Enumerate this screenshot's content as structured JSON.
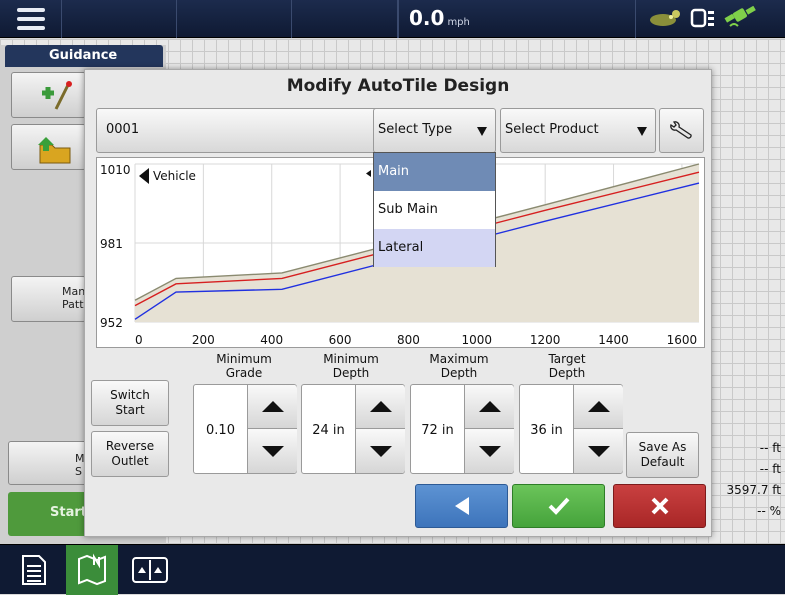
{
  "topbar": {
    "speed_value": "0.0",
    "speed_unit": "mph"
  },
  "background": {
    "guidance_tab": "Guidance",
    "btn_a": "N\nF",
    "btn_b": "L\nF",
    "btn_manage_pattern": "Man\nPatt",
    "btn_ms": "M\nS",
    "start_label": "Start",
    "stats": [
      "-- ft",
      "-- ft",
      "3597.7 ft",
      "-- %"
    ]
  },
  "modal": {
    "title": "Modify AutoTile Design",
    "name_value": "0001",
    "type_select": "Select Type",
    "product_select": "Select Product",
    "type_options": [
      "Main",
      "Sub Main",
      "Lateral"
    ],
    "switch_start": "Switch\nStart",
    "reverse_outlet": "Reverse\nOutlet",
    "save_default": "Save As\nDefault",
    "spinners": [
      {
        "label": "Minimum\nGrade",
        "value": "0.10"
      },
      {
        "label": "Minimum\nDepth",
        "value": "24 in"
      },
      {
        "label": "Maximum\nDepth",
        "value": "72 in"
      },
      {
        "label": "Target\nDepth",
        "value": "36 in"
      }
    ]
  },
  "chart_data": {
    "type": "line",
    "x_ticks": [
      "0",
      "200",
      "400",
      "600",
      "800",
      "1000",
      "1200",
      "1400",
      "1600"
    ],
    "y_ticks": [
      "952",
      "981",
      "1010"
    ],
    "xlim": [
      0,
      1650
    ],
    "ylim": [
      952,
      1010
    ],
    "annotations": [
      "Vehicle"
    ],
    "series": [
      {
        "color": "#8a8a70",
        "x": [
          0,
          120,
          430,
          1200,
          1650
        ],
        "values": [
          960,
          968,
          970,
          995,
          1010
        ]
      },
      {
        "color": "#d62020",
        "x": [
          0,
          120,
          430,
          1200,
          1650
        ],
        "values": [
          958,
          966,
          968,
          993,
          1007
        ]
      },
      {
        "color": "#2030e0",
        "x": [
          0,
          120,
          430,
          1200,
          1650
        ],
        "values": [
          953,
          963,
          964,
          989,
          1003
        ]
      }
    ],
    "fill_color": "#e6e1d4"
  },
  "colors": {
    "topbar": "#1c2b4d",
    "selected_option": "#6f8bb5",
    "hover_option": "#d3d6f3",
    "back": "#4a82c6",
    "ok": "#55b247",
    "cancel": "#b83232"
  }
}
